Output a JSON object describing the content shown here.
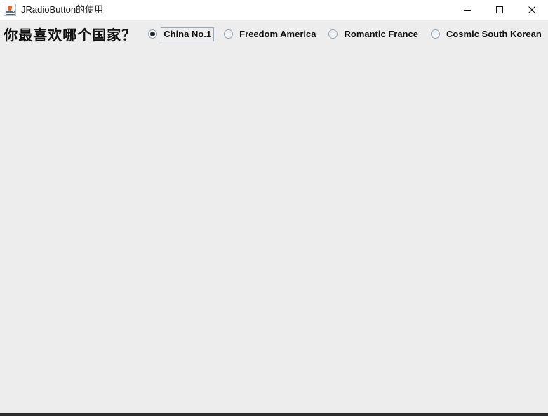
{
  "window": {
    "title": "JRadioButton的使用",
    "app_icon": "java-coffee-cup-icon",
    "controls": {
      "minimize": "minimize-icon",
      "maximize": "maximize-icon",
      "close": "close-icon"
    }
  },
  "panel": {
    "question_label": "你最喜欢哪个国家？",
    "radio_group": [
      {
        "label": "China No.1",
        "selected": true,
        "focused": true
      },
      {
        "label": "Freedom America",
        "selected": false,
        "focused": false
      },
      {
        "label": "Romantic France",
        "selected": false,
        "focused": false
      },
      {
        "label": "Cosmic South Korean",
        "selected": false,
        "focused": false
      }
    ]
  },
  "colors": {
    "titlebar_background": "#ffffff",
    "panel_background": "#ededed",
    "text": "#111111",
    "radio_border": "#93a5b4",
    "radio_dot": "#20242a",
    "focus_border": "#9aabbb",
    "bottom_edge": "#2b2b2b",
    "icon_accent": "#e8622a"
  }
}
